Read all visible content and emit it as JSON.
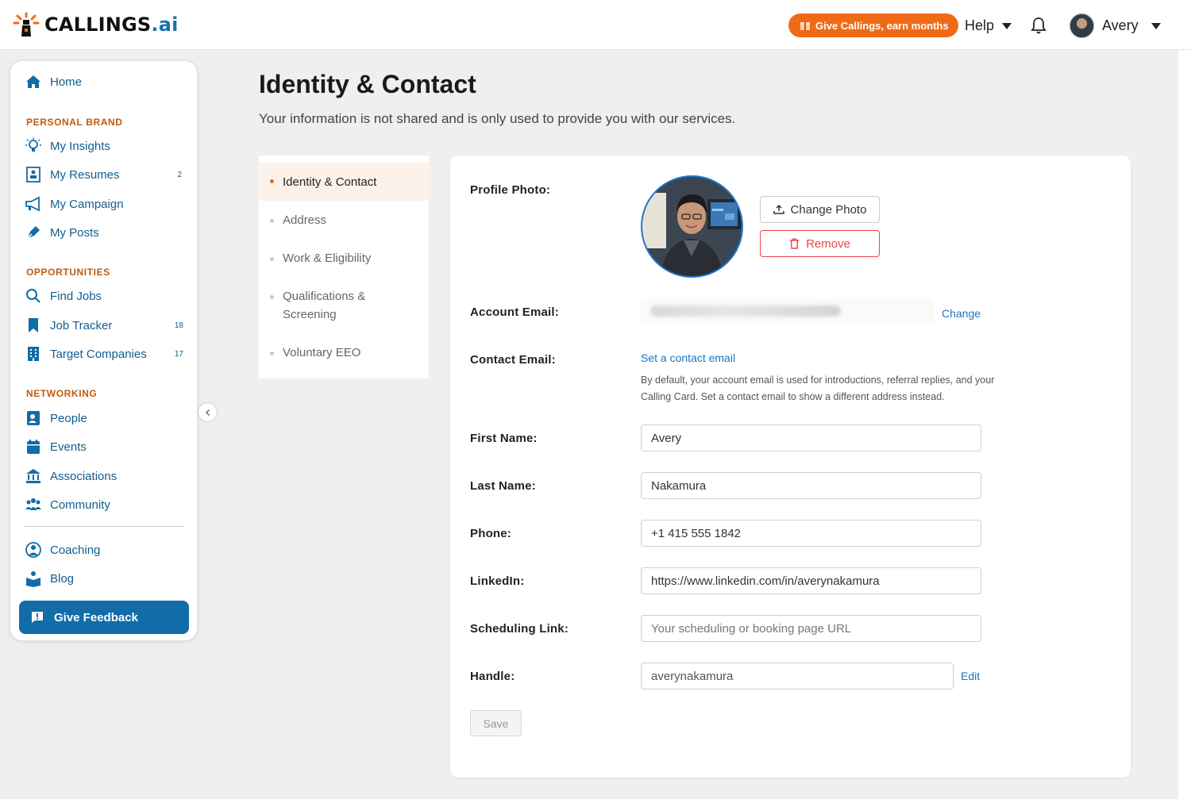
{
  "header": {
    "brand": "CALLINGS",
    "brand_suffix": ".ai",
    "promo_label": "Give Callings, earn months",
    "help_label": "Help",
    "user_name": "Avery"
  },
  "sidebar": {
    "home": "Home",
    "sections": {
      "personal_brand": "PERSONAL BRAND",
      "opportunities": "OPPORTUNITIES",
      "networking": "NETWORKING"
    },
    "items": {
      "insights": "My Insights",
      "resumes": "My Resumes",
      "resumes_count": "2",
      "campaign": "My Campaign",
      "posts": "My Posts",
      "find_jobs": "Find Jobs",
      "job_tracker": "Job Tracker",
      "job_tracker_count": "18",
      "target_companies": "Target Companies",
      "target_companies_count": "17",
      "people": "People",
      "events": "Events",
      "associations": "Associations",
      "community": "Community",
      "coaching": "Coaching",
      "blog": "Blog"
    },
    "feedback_label": "Give Feedback"
  },
  "page": {
    "title": "Identity & Contact",
    "subtitle": "Your information is not shared and is only used to provide you with our services."
  },
  "subnav": [
    "Identity & Contact",
    "Address",
    "Work & Eligibility",
    "Qualifications & Screening",
    "Voluntary EEO"
  ],
  "form": {
    "profile_photo_label": "Profile Photo:",
    "change_photo": "Change Photo",
    "remove": "Remove",
    "account_email_label": "Account Email:",
    "account_email_change": "Change",
    "contact_email_label": "Contact Email:",
    "set_contact_email": "Set a contact email",
    "contact_email_hint": "By default, your account email is used for introductions, referral replies, and your Calling Card. Set a contact email to show a different address instead.",
    "first_name_label": "First Name:",
    "first_name": "Avery",
    "last_name_label": "Last Name:",
    "last_name": "Nakamura",
    "phone_label": "Phone:",
    "phone": "+1 415 555 1842",
    "linkedin_label": "LinkedIn:",
    "linkedin": "https://www.linkedin.com/in/averynakamura",
    "scheduling_label": "Scheduling Link:",
    "scheduling_placeholder": "Your scheduling or booking page URL",
    "handle_label": "Handle:",
    "handle": "averynakamura",
    "handle_edit": "Edit",
    "save": "Save"
  },
  "colors": {
    "brand_blue": "#116ca7",
    "accent_orange": "#f06a16",
    "danger_red": "#ee4444",
    "link_blue": "#1a73c4"
  }
}
